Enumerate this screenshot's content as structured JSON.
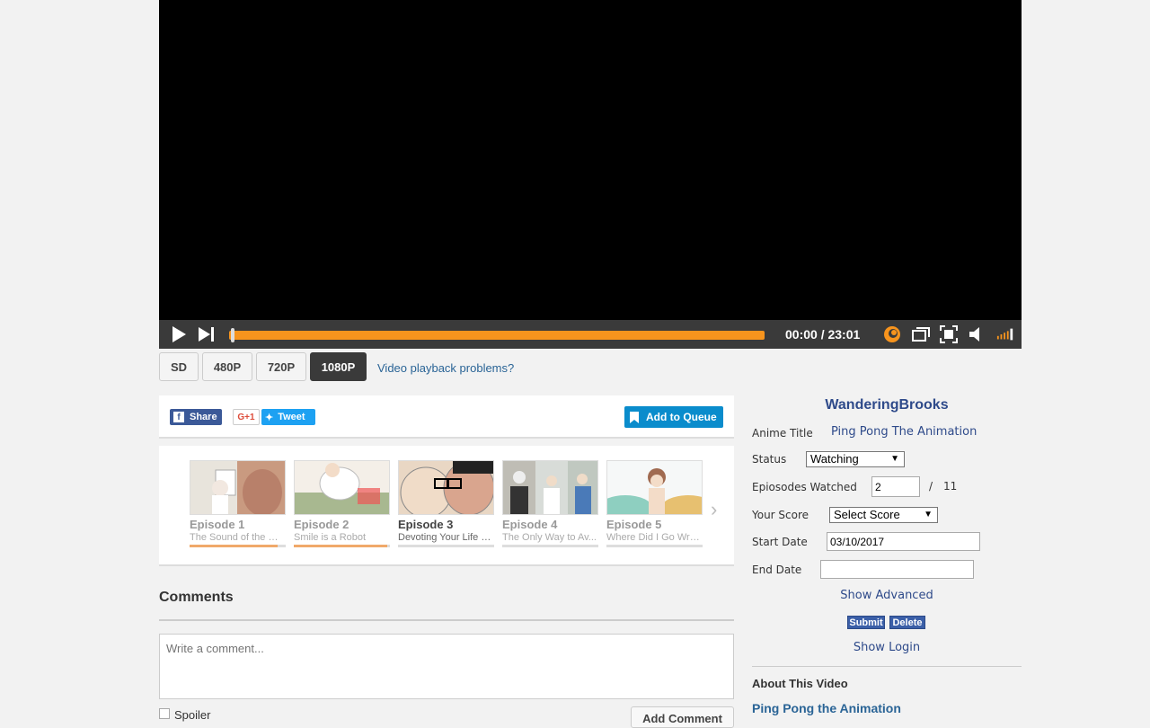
{
  "player": {
    "time": "00:00 / 23:01",
    "progress_fraction": 0.0,
    "quality_options": [
      "SD",
      "480P",
      "720P",
      "1080P"
    ],
    "selected_quality": "1080P",
    "playback_problems_link": "Video playback problems?"
  },
  "share": {
    "facebook_label": "Share",
    "gplus_label": "G+1",
    "tweet_label": "Tweet",
    "queue_label": "Add to Queue"
  },
  "episodes": [
    {
      "title": "Episode 1",
      "subtitle": "The Sound of the W...",
      "watched_fraction": 0.92,
      "current": false
    },
    {
      "title": "Episode 2",
      "subtitle": "Smile is a Robot",
      "watched_fraction": 0.97,
      "current": false
    },
    {
      "title": "Episode 3",
      "subtitle": "Devoting Your Life to...",
      "watched_fraction": 0.0,
      "current": true
    },
    {
      "title": "Episode 4",
      "subtitle": "The Only Way to Av...",
      "watched_fraction": 0.0,
      "current": false
    },
    {
      "title": "Episode 5",
      "subtitle": "Where Did I Go Wro...",
      "watched_fraction": 0.0,
      "current": false
    }
  ],
  "comments": {
    "title": "Comments",
    "placeholder": "Write a comment...",
    "spoiler_label": "Spoiler",
    "add_button": "Add Comment"
  },
  "tracker": {
    "username": "WanderingBrooks",
    "anime_title_label": "Anime Title",
    "anime_title_value": "Ping Pong The Animation",
    "status_label": "Status",
    "status_value": "Watching",
    "episodes_label": "Epiosodes Watched",
    "episodes_value": "2",
    "episodes_separator": "/",
    "episodes_total": "11",
    "score_label": "Your Score",
    "score_value": "Select Score",
    "start_label": "Start Date",
    "start_value": "03/10/2017",
    "end_label": "End Date",
    "end_value": "",
    "show_advanced": "Show Advanced",
    "submit_label": "Submit",
    "delete_label": "Delete",
    "show_login": "Show Login"
  },
  "about": {
    "title": "About This Video",
    "show_name": "Ping Pong the Animation"
  },
  "colors": {
    "accent": "#f7941d",
    "link": "#2e4a8a",
    "queue_button": "#0a8ccc"
  }
}
